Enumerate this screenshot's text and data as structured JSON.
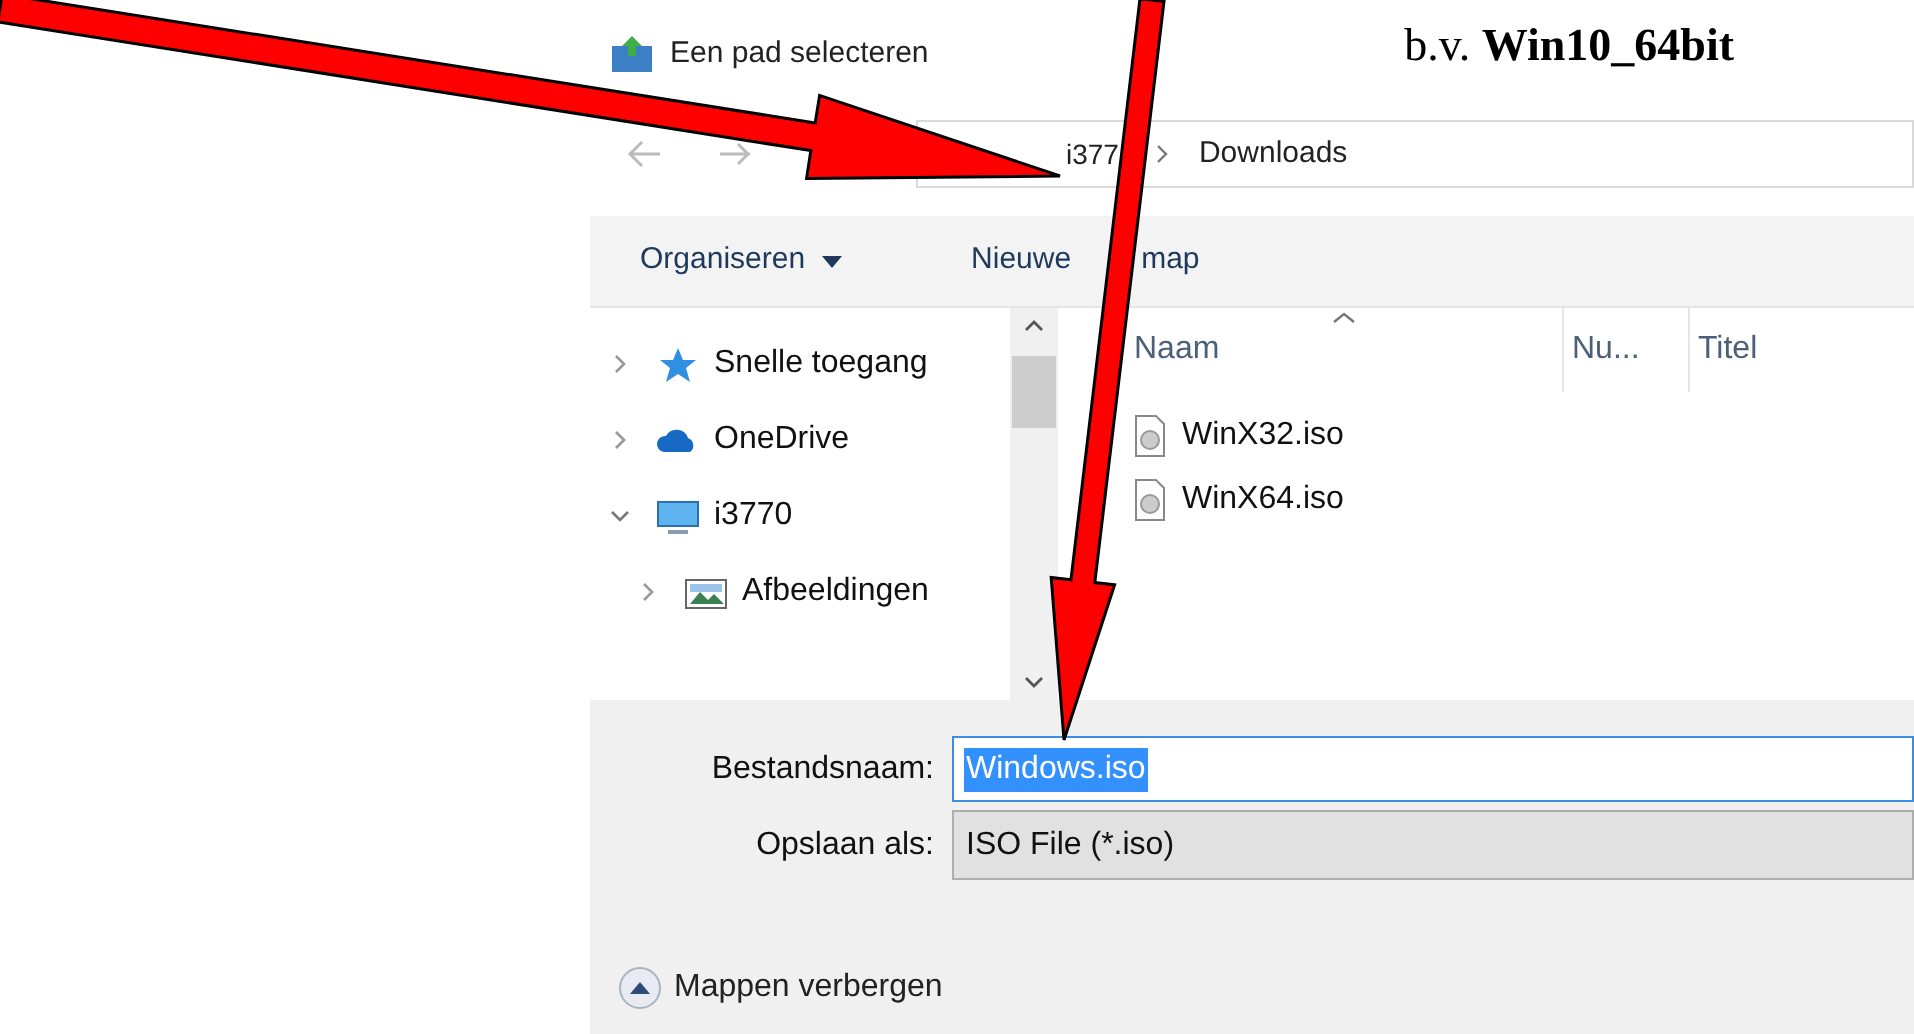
{
  "annotation": {
    "prefix": "b.v. ",
    "emphasis": "Win10_64bit"
  },
  "window": {
    "title": "Een pad selecteren"
  },
  "address_bar": {
    "crumbs": [
      "i377",
      "Downloads"
    ]
  },
  "toolbar": {
    "organize": "Organiseren",
    "new_folder": [
      "Nieuwe",
      "map"
    ]
  },
  "tree": [
    {
      "label": "Snelle toegang",
      "kind": "star",
      "expanded": false
    },
    {
      "label": "OneDrive",
      "kind": "cloud",
      "expanded": false
    },
    {
      "label": "i3770",
      "kind": "computer",
      "expanded": true,
      "children": [
        {
          "label": "Afbeeldingen",
          "kind": "pictures",
          "expanded": false
        }
      ]
    }
  ],
  "columns": [
    {
      "label": "Naam",
      "sorted": true
    },
    {
      "label": "Nu...",
      "sorted": false
    },
    {
      "label": "Titel",
      "sorted": false
    }
  ],
  "files": [
    "WinX32.iso",
    "WinX64.iso"
  ],
  "fields": [
    {
      "label": "Bestandsnaam:",
      "kind": "text",
      "value": "Windows.iso"
    },
    {
      "label": "Opslaan als:",
      "kind": "combo",
      "value": "ISO File (*.iso)"
    }
  ],
  "hide_folders": "Mappen verbergen"
}
